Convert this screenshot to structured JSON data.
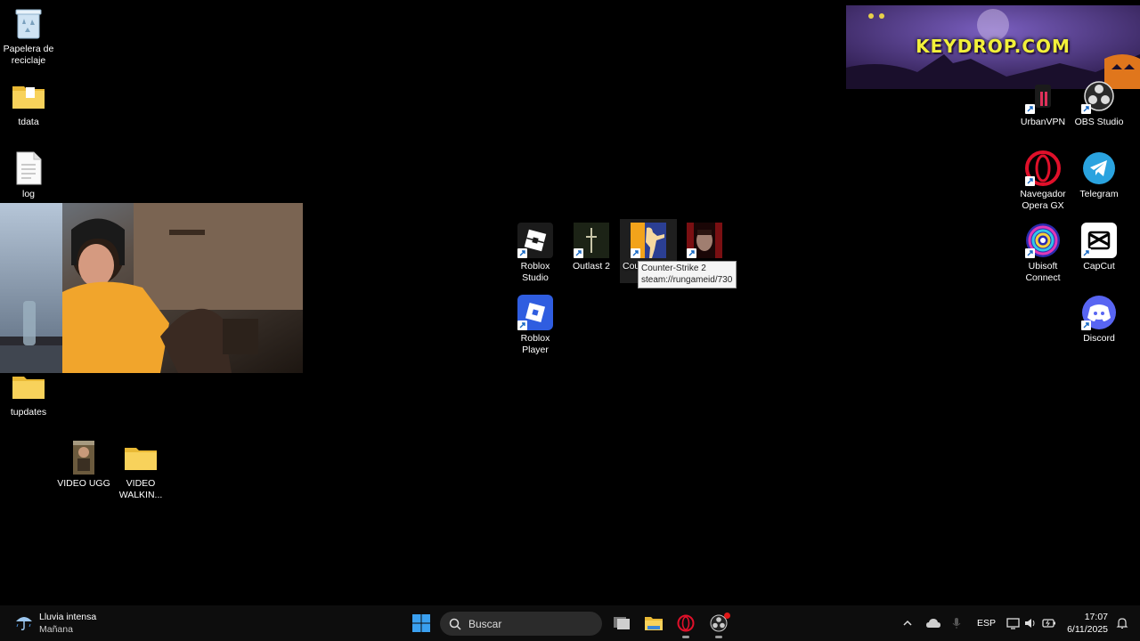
{
  "desktop": {
    "recycle_bin": "Papelera de reciclaje",
    "tdata": "tdata",
    "log": "log",
    "tupdates": "tupdates",
    "video_ugg": "VIDEO UGG",
    "video_walkin": "VIDEO WALKIN...",
    "roblox_studio": "Roblox Studio",
    "outlast2": "Outlast 2",
    "counter_strike_short": "Cou",
    "roblox_player": "Roblox Player",
    "urbanvpn": "UrbanVPN",
    "obs": "OBS Studio",
    "opera_gx": "Navegador Opera GX",
    "telegram": "Telegram",
    "ubisoft": "Ubisoft Connect",
    "capcut": "CapCut",
    "discord": "Discord"
  },
  "tooltip": {
    "title": "Counter-Strike 2",
    "path": "steam://rungameid/730"
  },
  "overlay": {
    "banner_text": "KEYDROP.COM"
  },
  "taskbar": {
    "weather_main": "Lluvia intensa",
    "weather_sub": "Mañana",
    "search_placeholder": "Buscar",
    "lang": "ESP",
    "time": "17:07",
    "date": "6/11/2025"
  },
  "colors": {
    "folder": "#f4c542",
    "discord": "#5865f2",
    "telegram": "#2aa3df",
    "opera": "#e0102a",
    "banner_text": "#f2f03a"
  }
}
